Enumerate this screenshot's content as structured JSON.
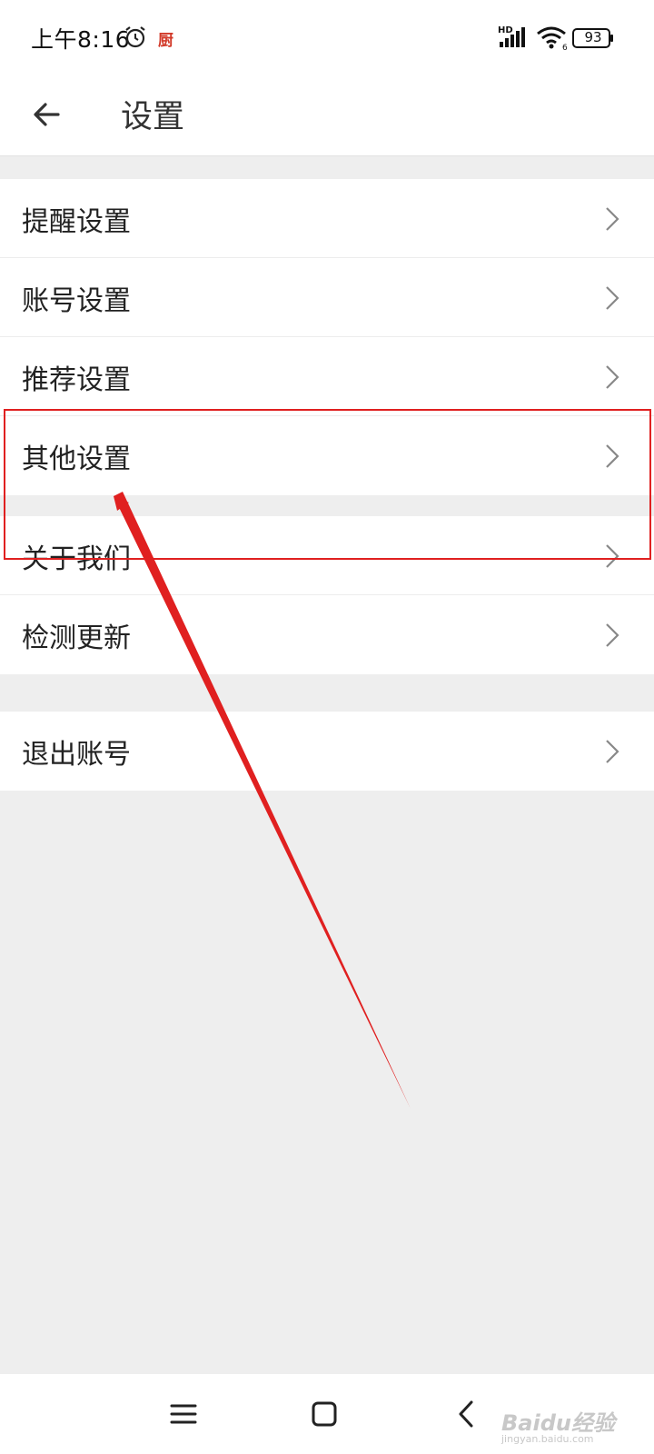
{
  "status_bar": {
    "time": "上午8:16",
    "app_badge": "厨",
    "network": "HD",
    "battery": "93"
  },
  "header": {
    "title": "设置"
  },
  "menu": {
    "group1": [
      {
        "label": "提醒设置"
      },
      {
        "label": "账号设置"
      },
      {
        "label": "推荐设置"
      },
      {
        "label": "其他设置"
      }
    ],
    "group2": [
      {
        "label": "关于我们"
      },
      {
        "label": "检测更新"
      }
    ],
    "group3": [
      {
        "label": "退出账号"
      }
    ]
  },
  "annotation": {
    "color": "#e02020"
  },
  "watermark": {
    "brand": "Baidu经验",
    "url": "jingyan.baidu.com"
  },
  "icons": [
    "alarm-icon",
    "signal-icon",
    "wifi-icon",
    "battery-icon",
    "back-arrow-icon",
    "chevron-right-icon",
    "menu-lines-icon",
    "home-square-icon",
    "back-chevron-icon"
  ]
}
